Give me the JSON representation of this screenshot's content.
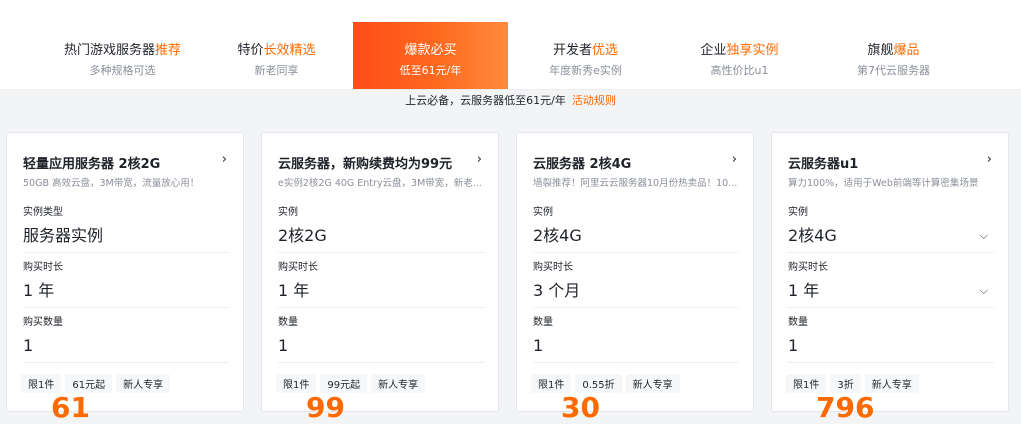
{
  "tabs": [
    {
      "title_main": "热门游戏服务器",
      "title_highlight": "推荐",
      "subtitle": "多种规格可选"
    },
    {
      "title_main": "特价",
      "title_highlight": "长效精选",
      "subtitle": "新老同享"
    },
    {
      "title_main": "爆款必买",
      "title_highlight": "",
      "subtitle": "低至61元/年",
      "active": true
    },
    {
      "title_main": "开发者",
      "title_highlight": "优选",
      "subtitle": "年度新秀e实例"
    },
    {
      "title_main": "企业",
      "title_highlight": "独享实例",
      "subtitle": "高性价比u1"
    },
    {
      "title_main": "旗舰",
      "title_highlight": "爆品",
      "subtitle": "第7代云服务器"
    }
  ],
  "notice": {
    "text": "上云必备，云服务器低至61元/年",
    "link": "活动规则"
  },
  "cards": [
    {
      "title": "轻量应用服务器 2核2G",
      "desc": "50GB 高效云盘，3M带宽，流量放心用！",
      "f1_label": "实例类型",
      "f1_value": "服务器实例",
      "f2_label": "购买时长",
      "f2_value": "1 年",
      "f3_label": "购买数量",
      "f3_value": "1",
      "tags": [
        "限1件",
        "61元起",
        "新人专享"
      ],
      "price": "61"
    },
    {
      "title": "云服务器，新购续费均为99元",
      "desc": "e实例2核2G 40G Entry云盘，3M带宽，新老...",
      "f1_label": "实例",
      "f1_value": "2核2G",
      "f2_label": "购买时长",
      "f2_value": "1 年",
      "f3_label": "数量",
      "f3_value": "1",
      "tags": [
        "限1件",
        "99元起",
        "新人专享"
      ],
      "price": "99"
    },
    {
      "title": "云服务器 2核4G",
      "desc": "墙裂推荐！阿里云云服务器10月份热卖品！10...",
      "f1_label": "实例",
      "f1_value": "2核4G",
      "f2_label": "购买时长",
      "f2_value": "3 个月",
      "f3_label": "数量",
      "f3_value": "1",
      "tags": [
        "限1件",
        "0.55折",
        "新人专享"
      ],
      "price": "30"
    },
    {
      "title": "云服务器u1",
      "desc": "算力100%，适用于Web前端等计算密集场景",
      "f1_label": "实例",
      "f1_value": "2核4G",
      "f2_label": "购买时长",
      "f2_value": "1 年",
      "f3_label": "数量",
      "f3_value": "1",
      "tags": [
        "限1件",
        "3折",
        "新人专享"
      ],
      "price": "796"
    }
  ]
}
